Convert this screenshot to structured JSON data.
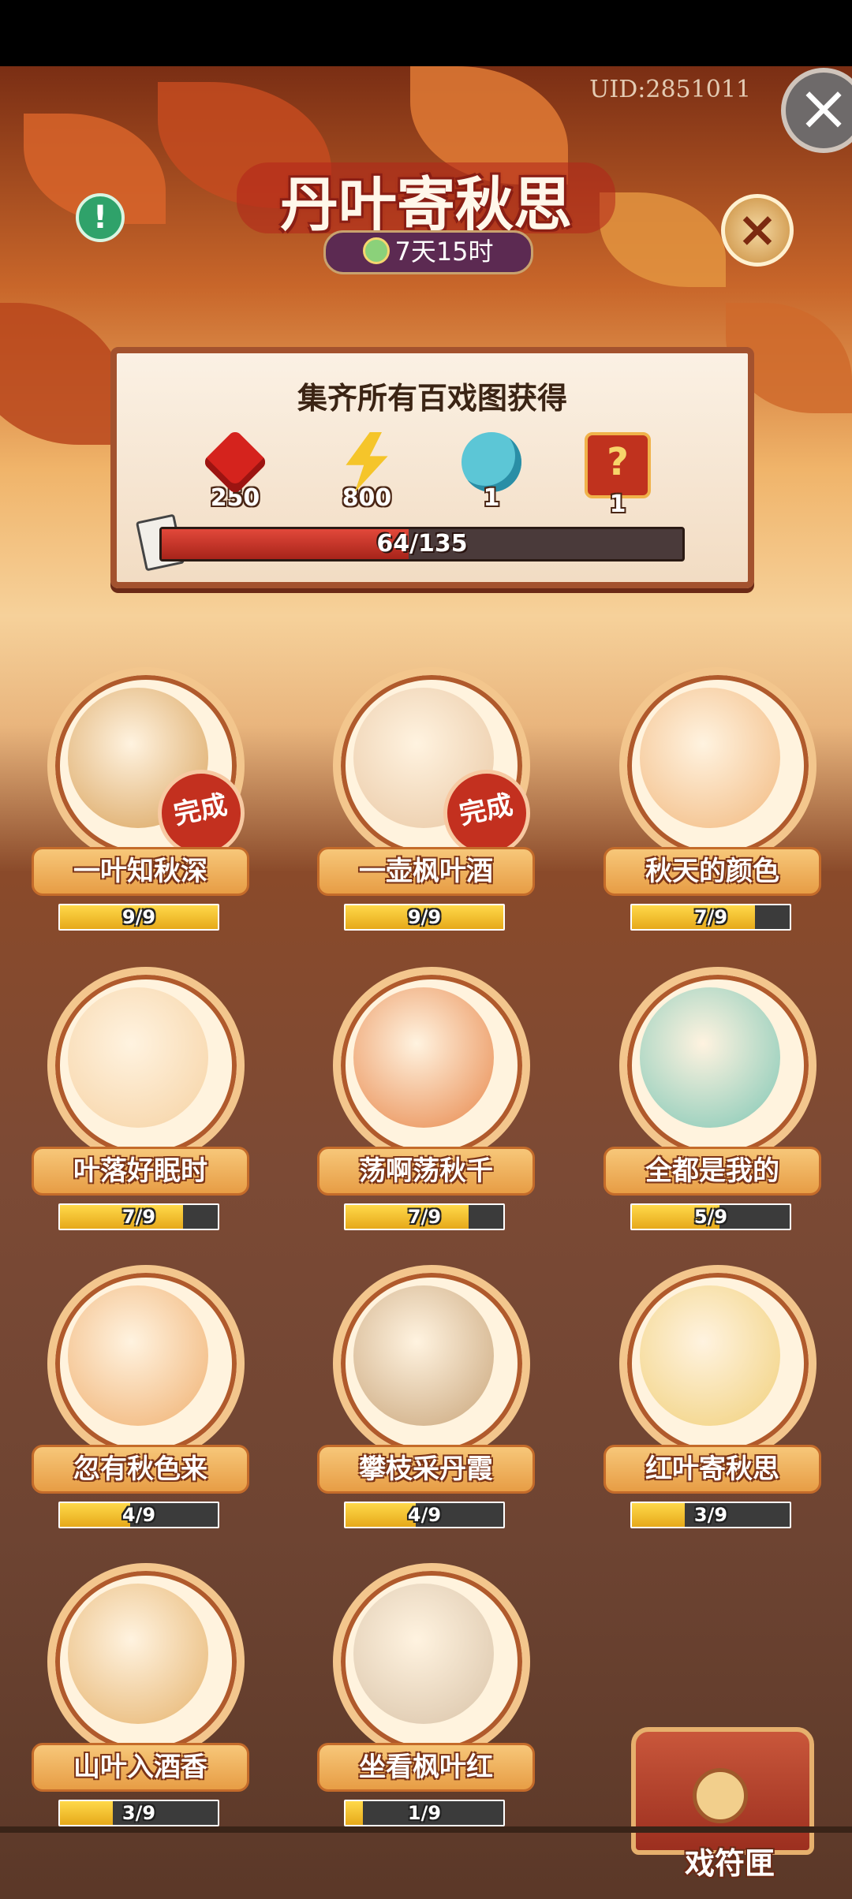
{
  "header": {
    "uid": "UID:2851011",
    "title": "丹叶寄秋思",
    "timer": "7天15时"
  },
  "reward_panel": {
    "title": "集齐所有百戏图获得",
    "rewards": [
      {
        "icon": "ruby-gem-icon",
        "qty": "250"
      },
      {
        "icon": "lightning-bolt-icon",
        "qty": "800"
      },
      {
        "icon": "magic-gourd-icon",
        "qty": "1"
      },
      {
        "icon": "mystery-chest-icon",
        "qty": "1"
      }
    ],
    "progress_text": "64/135",
    "progress_value": 0.474
  },
  "collections": [
    {
      "name": "一叶知秋深",
      "progress": "9/9",
      "fraction": 1.0,
      "done": true,
      "done_label": "完成"
    },
    {
      "name": "一壶枫叶酒",
      "progress": "9/9",
      "fraction": 1.0,
      "done": true,
      "done_label": "完成"
    },
    {
      "name": "秋天的颜色",
      "progress": "7/9",
      "fraction": 0.778,
      "done": false
    },
    {
      "name": "叶落好眠时",
      "progress": "7/9",
      "fraction": 0.778,
      "done": false
    },
    {
      "name": "荡啊荡秋千",
      "progress": "7/9",
      "fraction": 0.778,
      "done": false
    },
    {
      "name": "全都是我的",
      "progress": "5/9",
      "fraction": 0.556,
      "done": false
    },
    {
      "name": "忽有秋色来",
      "progress": "4/9",
      "fraction": 0.444,
      "done": false
    },
    {
      "name": "攀枝采丹霞",
      "progress": "4/9",
      "fraction": 0.444,
      "done": false
    },
    {
      "name": "红叶寄秋思",
      "progress": "3/9",
      "fraction": 0.333,
      "done": false
    },
    {
      "name": "山叶入酒香",
      "progress": "3/9",
      "fraction": 0.333,
      "done": false
    },
    {
      "name": "坐看枫叶红",
      "progress": "1/9",
      "fraction": 0.111,
      "done": false
    }
  ],
  "bottom": {
    "chest_label": "戏符匣"
  },
  "colors": {
    "accent_red": "#c3301f",
    "label_orange": "#e79d45",
    "bar_yellow": "#ffd94a"
  }
}
